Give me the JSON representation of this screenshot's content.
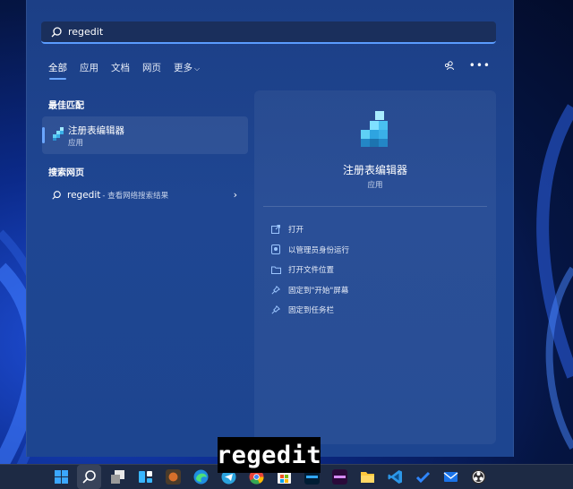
{
  "search": {
    "query": "regedit"
  },
  "tabs": [
    {
      "label": "全部",
      "active": true
    },
    {
      "label": "应用",
      "active": false
    },
    {
      "label": "文档",
      "active": false
    },
    {
      "label": "网页",
      "active": false
    },
    {
      "label": "更多",
      "active": false
    }
  ],
  "best_match": {
    "heading": "最佳匹配",
    "title": "注册表编辑器",
    "subtitle": "应用",
    "icon": "registry-editor-icon"
  },
  "web_search": {
    "heading": "搜索网页",
    "query": "regedit",
    "suffix": " - 查看网络搜索结果"
  },
  "preview": {
    "title": "注册表编辑器",
    "subtitle": "应用",
    "actions": [
      {
        "label": "打开",
        "icon": "open-icon"
      },
      {
        "label": "以管理员身份运行",
        "icon": "shield-icon"
      },
      {
        "label": "打开文件位置",
        "icon": "folder-icon"
      },
      {
        "label": "固定到\"开始\"屏幕",
        "icon": "pin-icon"
      },
      {
        "label": "固定到任务栏",
        "icon": "pin-icon"
      }
    ]
  },
  "caption": "regedit",
  "colors": {
    "accent": "#6aa6ff",
    "panel": "#1f4692",
    "taskbar": "#1d2a44"
  }
}
